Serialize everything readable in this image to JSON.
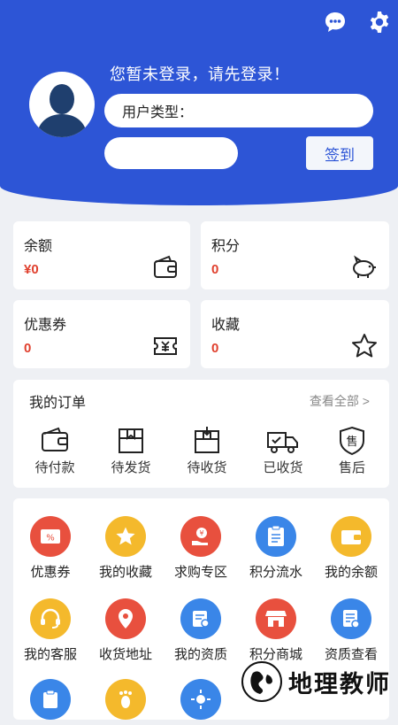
{
  "header": {
    "login_prompt": "您暂未登录，请先登录！",
    "user_type_label": "用户类型：",
    "signin_label": "签到",
    "icons": [
      "chat-icon",
      "settings-icon"
    ]
  },
  "stats": [
    {
      "label": "余额",
      "value": "¥0",
      "icon": "wallet-icon"
    },
    {
      "label": "积分",
      "value": "0",
      "icon": "piggy-bank-icon"
    },
    {
      "label": "优惠券",
      "value": "0",
      "icon": "coupon-icon"
    },
    {
      "label": "收藏",
      "value": "0",
      "icon": "star-icon"
    }
  ],
  "orders": {
    "title": "我的订单",
    "view_all": "查看全部 >",
    "items": [
      "待付款",
      "待发货",
      "待收货",
      "已收货",
      "售后"
    ]
  },
  "grid": [
    {
      "label": "优惠券",
      "color": "#e8503e"
    },
    {
      "label": "我的收藏",
      "color": "#f4b92c"
    },
    {
      "label": "求购专区",
      "color": "#e8503e"
    },
    {
      "label": "积分流水",
      "color": "#3a86e8"
    },
    {
      "label": "我的余额",
      "color": "#f4b92c"
    },
    {
      "label": "我的客服",
      "color": "#f4b92c"
    },
    {
      "label": "收货地址",
      "color": "#e8503e"
    },
    {
      "label": "我的资质",
      "color": "#3a86e8"
    },
    {
      "label": "积分商城",
      "color": "#e8503e"
    },
    {
      "label": "资质查看",
      "color": "#3a86e8"
    },
    {
      "label": "",
      "color": "#3a86e8"
    },
    {
      "label": "",
      "color": "#f4b92c"
    },
    {
      "label": "",
      "color": "#3a86e8"
    }
  ],
  "watermark": {
    "text": "地理教师"
  },
  "colors": {
    "primary": "#2d55d6",
    "accent_red": "#e0402e"
  }
}
